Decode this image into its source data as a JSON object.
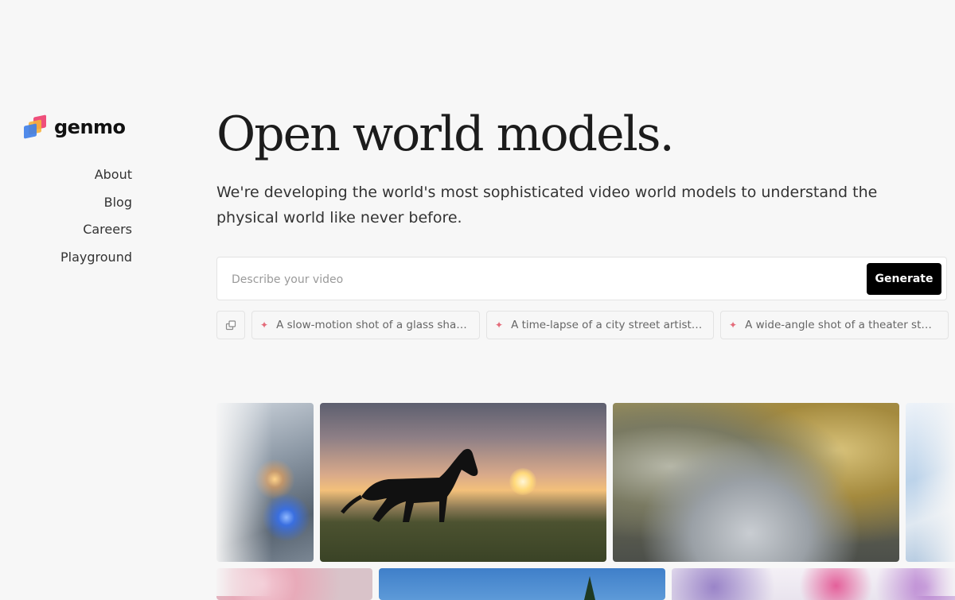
{
  "brand": {
    "name": "genmo"
  },
  "nav": {
    "items": [
      {
        "label": "About"
      },
      {
        "label": "Blog"
      },
      {
        "label": "Careers"
      },
      {
        "label": "Playground"
      }
    ]
  },
  "hero": {
    "title": "Open world models.",
    "subtitle": "We're developing the world's most sophisticated video world models to understand the physical world like never before."
  },
  "prompt": {
    "placeholder": "Describe your video",
    "value": "",
    "generate_label": "Generate"
  },
  "suggestions": [
    {
      "label": "A slow-motion shot of a glass shatt..."
    },
    {
      "label": "A time-lapse of a city street artist c..."
    },
    {
      "label": "A wide-angle shot of a theater stag..."
    }
  ],
  "icons": {
    "shuffle": "shuffle-icon",
    "sparkle": "sparkle-icon"
  },
  "colors": {
    "background": "#f7f7f7",
    "button": "#000000",
    "sparkle": "#e46b7a",
    "logo_pink": "#ef4f7b",
    "logo_orange": "#f6b13c",
    "logo_blue": "#3e7ee8"
  }
}
